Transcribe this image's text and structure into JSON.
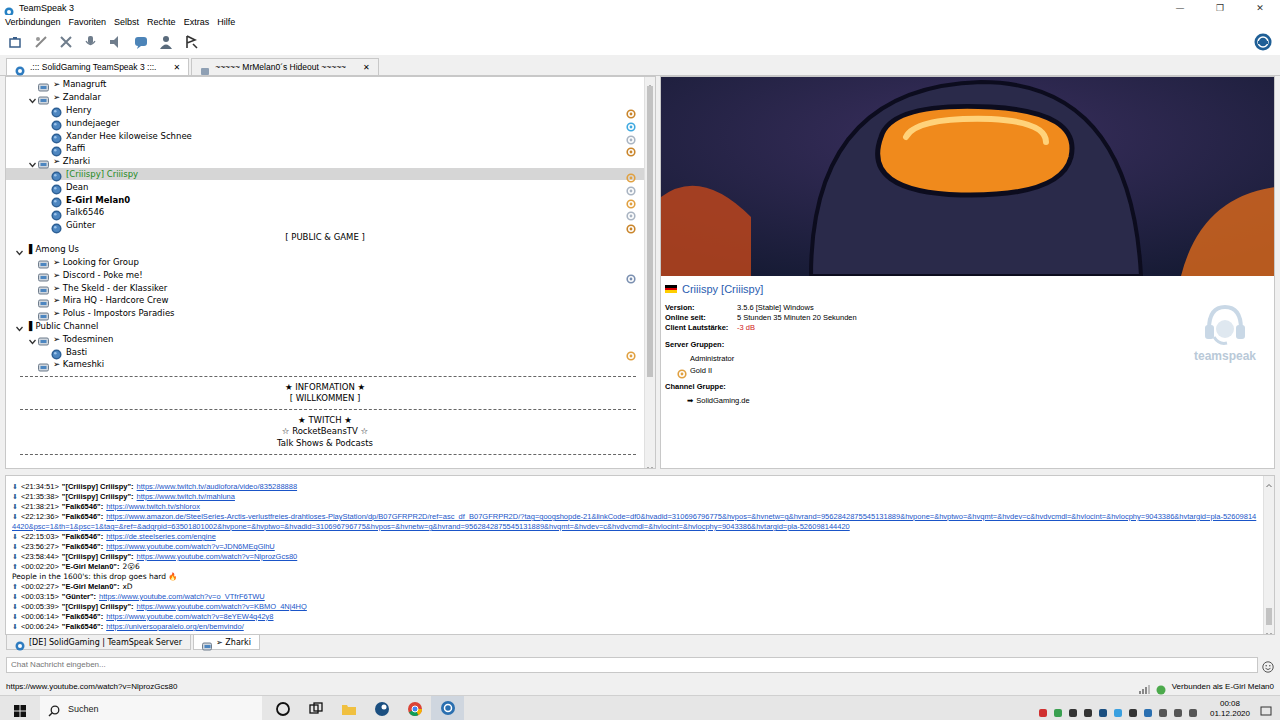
{
  "window": {
    "title": "TeamSpeak 3",
    "controls": [
      "—",
      "❐",
      "✕"
    ]
  },
  "menu": [
    "Verbindungen",
    "Favoriten",
    "Selbst",
    "Rechte",
    "Extras",
    "Hilfe"
  ],
  "server_tabs": [
    {
      "label": ".::: SolidGaming TeamSpeak 3 :::.",
      "selected": true,
      "close": "✕"
    },
    {
      "label": "~~~~~ MrMelan0´s Hideout ~~~~~",
      "selected": false,
      "close": "✕"
    }
  ],
  "tree": [
    {
      "kind": "channel",
      "label": "➢ Managruft",
      "depth": 1,
      "selected": false,
      "badge": null
    },
    {
      "kind": "channel",
      "label": "➢ Zandalar",
      "depth": 1,
      "expanded": true,
      "selected": false,
      "badge": null
    },
    {
      "kind": "user",
      "label": "Henry",
      "depth": 2,
      "selected": false,
      "self": false,
      "badge": "#c9852b"
    },
    {
      "kind": "user",
      "label": "hundejaeger",
      "depth": 2,
      "selected": false,
      "self": false,
      "badge": "#3fa9e0"
    },
    {
      "kind": "user",
      "label": "Xander Hee kiloweise Schnee",
      "depth": 2,
      "selected": false,
      "self": false,
      "badge": "#a9b4c2"
    },
    {
      "kind": "user",
      "label": "Raffi",
      "depth": 2,
      "selected": false,
      "self": false,
      "badge": "#c9852b"
    },
    {
      "kind": "channel",
      "label": "➢ Zharki",
      "depth": 1,
      "expanded": true,
      "selected": false,
      "badge": null
    },
    {
      "kind": "user",
      "label": "[Criiispy] Criiispy",
      "depth": 2,
      "selected": true,
      "self": false,
      "badge": "#e0a040"
    },
    {
      "kind": "user",
      "label": "Dean",
      "depth": 2,
      "selected": false,
      "self": false,
      "badge": "#a9b4c2"
    },
    {
      "kind": "user",
      "label": "E-Girl Melan0",
      "depth": 2,
      "selected": false,
      "self": true,
      "badge": "#e0a040"
    },
    {
      "kind": "user",
      "label": "Falk6546",
      "depth": 2,
      "selected": false,
      "self": false,
      "badge": "#a9b4c2"
    },
    {
      "kind": "user",
      "label": "Günter",
      "depth": 2,
      "selected": false,
      "self": false,
      "badge": "#c9852b"
    },
    {
      "kind": "spacer",
      "label": "[ PUBLIC & GAME ]",
      "selected": false
    },
    {
      "kind": "category",
      "label": "▌Among Us",
      "depth": 0,
      "expanded": true,
      "selected": false,
      "badge": null
    },
    {
      "kind": "channel",
      "label": "➢ Looking for Group",
      "depth": 1,
      "selected": false,
      "badge": null
    },
    {
      "kind": "channel",
      "label": "➢ Discord - Poke me!",
      "depth": 1,
      "selected": false,
      "badge": "#7a8fb0"
    },
    {
      "kind": "channel",
      "label": "➢ The Skeld - der Klassiker",
      "depth": 1,
      "selected": false,
      "badge": null
    },
    {
      "kind": "channel",
      "label": "➢ Mira HQ - Hardcore Crew",
      "depth": 1,
      "selected": false,
      "badge": null
    },
    {
      "kind": "channel",
      "label": "➢ Polus -  Impostors Paradies",
      "depth": 1,
      "selected": false,
      "badge": null
    },
    {
      "kind": "category",
      "label": "▌Public Channel",
      "depth": 0,
      "expanded": true,
      "selected": false,
      "badge": null
    },
    {
      "kind": "channel",
      "label": "➢ Todesminen",
      "depth": 1,
      "expanded": true,
      "selected": false,
      "badge": null
    },
    {
      "kind": "user",
      "label": "Basti",
      "depth": 2,
      "selected": false,
      "self": false,
      "badge": "#e0a040"
    },
    {
      "kind": "channel",
      "label": "➢ Kameshki",
      "depth": 1,
      "selected": false,
      "badge": null
    },
    {
      "kind": "divider",
      "selected": false
    },
    {
      "kind": "spacer",
      "label": "★ INFORMATION ★",
      "selected": false
    },
    {
      "kind": "spacer",
      "label": "[ WILLKOMMEN ]",
      "selected": false
    },
    {
      "kind": "divider",
      "selected": false
    },
    {
      "kind": "spacer",
      "label": "★ TWITCH ★",
      "selected": false
    },
    {
      "kind": "spacer",
      "label": "☆ RocketBeansTV ☆",
      "selected": false
    },
    {
      "kind": "spacer",
      "label": "Talk Shows & Podcasts",
      "selected": false
    },
    {
      "kind": "divider",
      "selected": false
    }
  ],
  "client_info": {
    "name": "Criiispy [Criiispy]",
    "fields": [
      {
        "label": "Version:",
        "value": "3.5.6 [Stable] Windows",
        "warn": false
      },
      {
        "label": "Online seit:",
        "value": "5 Stunden 35 Minuten 20 Sekunden",
        "warn": false
      },
      {
        "label": "Client Lautstärke:",
        "value": "-3 dB",
        "warn": true
      }
    ],
    "server_groups_label": "Server Gruppen:",
    "server_groups": [
      {
        "label": "Administrator",
        "badge": null
      },
      {
        "label": "Gold II",
        "badge": "#e0a040"
      }
    ],
    "channel_group_label": "Channel Gruppe:",
    "channel_groups": [
      {
        "icon": "➡",
        "label": "SolidGaming.de"
      }
    ],
    "logo_text": "teamspeak"
  },
  "chat": {
    "lines": [
      {
        "dir": "⬇",
        "time": "<21:34:51>",
        "name": "\"[Criiispy] Criiispy\":",
        "text": "https://www.twitch.tv/audiofora/video/835288888",
        "link": true
      },
      {
        "dir": "⬇",
        "time": "<21:35:38>",
        "name": "\"[Criiispy] Criiispy\":",
        "text": "https://www.twitch.tv/mahluna",
        "link": true
      },
      {
        "dir": "⬇",
        "time": "<21:38:21>",
        "name": "\"Falk6546\":",
        "text": "https://www.twitch.tv/shlorox",
        "link": true
      },
      {
        "dir": "⬇",
        "time": "<22:12:36>",
        "name": "\"Falk6546\":",
        "text": "https://www.amazon.de/SteelSeries-Arctis-verlustfreies-drahtloses-PlayStation/dp/B07GFRPR2D/ref=asc_df_B07GFRPR2D/?tag=googshopde-21&linkCode=df0&hvadid=310696796775&hvpos=&hvnetw=g&hvrand=9562842875545131889&hvpone=&hvptwo=&hvqmt=&hvdev=c&hvdvcmdl=&hvlocint=&hvlocphy=9043386&hvtargid=pla-526098144420&psc=1&th=1&psc=1&tag=&ref=&adgrpid=63501801002&hvpone=&hvptwo=&hvadid=310696796775&hvpos=&hvnetw=g&hvrand=9562842875545131889&hvqmt=&hvdev=c&hvdvcmdl=&hvlocint=&hvlocphy=9043386&hvtargid=pla-526098144420",
        "link": true
      },
      {
        "dir": "⬇",
        "time": "<22:15:03>",
        "name": "\"Falk6546\":",
        "text": "https://de.steelseries.com/engine",
        "link": true
      },
      {
        "dir": "⬇",
        "time": "<23:56:27>",
        "name": "\"Falk6546\":",
        "text": "https://www.youtube.com/watch?v=JDN6MEqGlhU",
        "link": true
      },
      {
        "dir": "⬇",
        "time": "<23:58:44>",
        "name": "\"[Criiispy] Criiispy\":",
        "text": "https://www.youtube.com/watch?v=NlprozGcs80",
        "link": true
      },
      {
        "dir": "⬆",
        "time": "<00:02:20>",
        "name": "\"E-Girl Melan0\":",
        "text": "2😮6",
        "link": false,
        "more": "People in the 1600's: this drop goes hard 🔥"
      },
      {
        "dir": "⬆",
        "time": "<00:02:27>",
        "name": "\"E-Girl Melan0\":",
        "text": "xD",
        "link": false
      },
      {
        "dir": "⬇",
        "time": "<00:03:15>",
        "name": "\"Günter\":",
        "text": "https://www.youtube.com/watch?v=o_VTfrF6TWU",
        "link": true
      },
      {
        "dir": "⬇",
        "time": "<00:05:39>",
        "name": "\"[Criiispy] Criiispy\":",
        "text": "https://www.youtube.com/watch?v=KBMO_4Nj4HQ",
        "link": true
      },
      {
        "dir": "⬇",
        "time": "<00:06:14>",
        "name": "\"Falk6546\":",
        "text": "https://www.youtube.com/watch?v=8eYEW4q42y8",
        "link": true
      },
      {
        "dir": "⬇",
        "time": "<00:06:24>",
        "name": "\"Falk6546\":",
        "text": "https://universoparalelo.org/en/bemvindo/",
        "link": true
      }
    ]
  },
  "chat_tabs": [
    {
      "label": "[DE] SolidGaming | TeamSpeak Server",
      "selected": false
    },
    {
      "label": "➢ Zharki",
      "selected": true
    }
  ],
  "chat_input": {
    "placeholder": "Chat Nachricht eingeben..."
  },
  "status_bar": {
    "left": "https://www.youtube.com/watch?v=NlprozGcs80",
    "right": "Verbunden als E-Girl Melan0"
  },
  "taskbar": {
    "search": "Suchen",
    "time": "00:08",
    "date": "01.12.2020"
  }
}
